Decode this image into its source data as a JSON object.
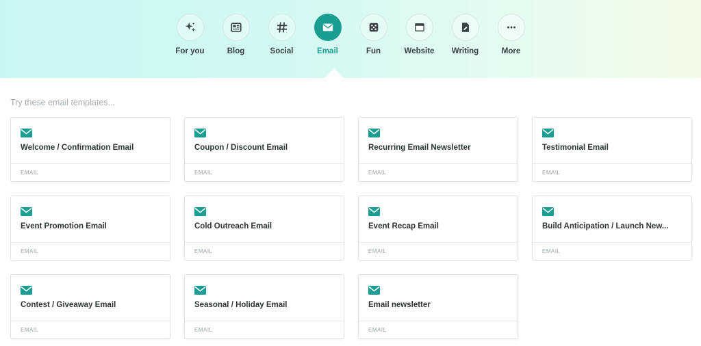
{
  "colors": {
    "accent": "#1b9e92",
    "heroStart": "#c7f7f4",
    "heroEnd": "#f3fbe7"
  },
  "categories": [
    {
      "label": "For you",
      "icon": "sparkle-icon"
    },
    {
      "label": "Blog",
      "icon": "newspaper-icon"
    },
    {
      "label": "Social",
      "icon": "hashtag-icon"
    },
    {
      "label": "Email",
      "icon": "envelope-icon",
      "active": true
    },
    {
      "label": "Fun",
      "icon": "dice-icon"
    },
    {
      "label": "Website",
      "icon": "browser-window-icon"
    },
    {
      "label": "Writing",
      "icon": "document-pen-icon"
    },
    {
      "label": "More",
      "icon": "more-dots-icon"
    }
  ],
  "section": {
    "title": "Try these email templates..."
  },
  "templates": [
    {
      "title": "Welcome / Confirmation Email",
      "tag": "EMAIL",
      "icon": "envelope-icon"
    },
    {
      "title": "Coupon / Discount Email",
      "tag": "EMAIL",
      "icon": "envelope-icon"
    },
    {
      "title": "Recurring Email Newsletter",
      "tag": "EMAIL",
      "icon": "envelope-icon"
    },
    {
      "title": "Testimonial Email",
      "tag": "EMAIL",
      "icon": "envelope-icon"
    },
    {
      "title": "Event Promotion Email",
      "tag": "EMAIL",
      "icon": "envelope-icon"
    },
    {
      "title": "Cold Outreach Email",
      "tag": "EMAIL",
      "icon": "envelope-icon"
    },
    {
      "title": "Event Recap Email",
      "tag": "EMAIL",
      "icon": "envelope-icon"
    },
    {
      "title": "Build Anticipation / Launch New...",
      "tag": "EMAIL",
      "icon": "envelope-icon"
    },
    {
      "title": "Contest / Giveaway Email",
      "tag": "EMAIL",
      "icon": "envelope-icon"
    },
    {
      "title": "Seasonal / Holiday Email",
      "tag": "EMAIL",
      "icon": "envelope-icon"
    },
    {
      "title": "Email newsletter",
      "tag": "EMAIL",
      "icon": "envelope-icon"
    }
  ]
}
